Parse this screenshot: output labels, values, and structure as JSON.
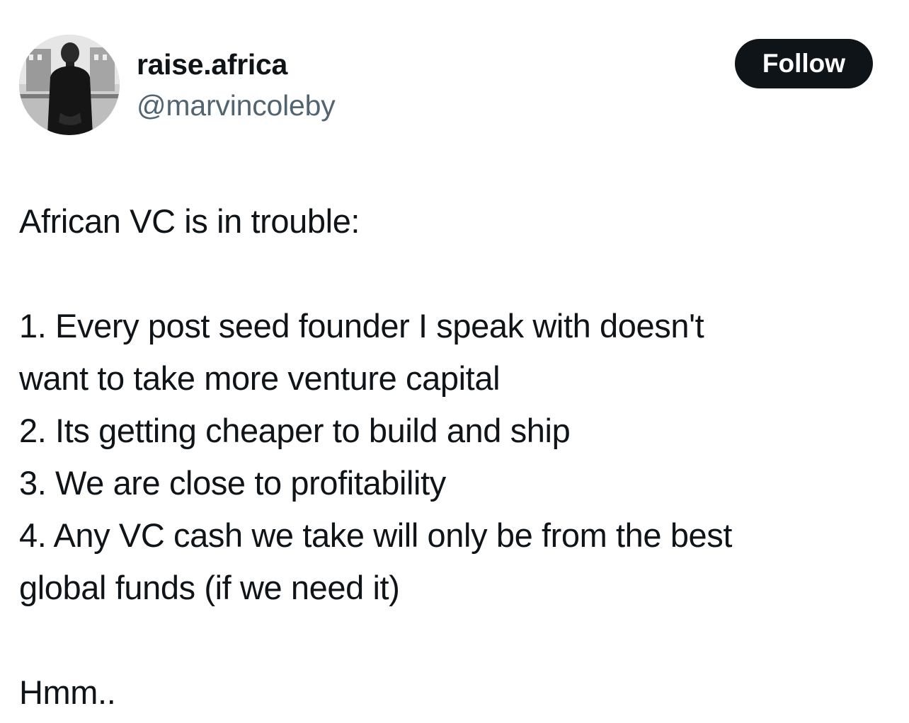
{
  "author": {
    "display_name": "raise.africa",
    "handle": "@marvincoleby",
    "avatar_icon": "profile-photo-avatar"
  },
  "actions": {
    "follow_label": "Follow"
  },
  "tweet": {
    "intro": "African VC is in trouble:",
    "lines": [
      "1. Every post seed founder I speak with doesn't",
      "want to take more venture capital",
      "2. Its getting cheaper to build and ship",
      "3. We are close to profitability",
      "4. Any VC cash we take will only be from the best",
      "global funds (if we need it)"
    ],
    "outro": "Hmm.."
  },
  "colors": {
    "text_primary": "#0f1419",
    "text_secondary": "#536471",
    "button_bg": "#0f1419",
    "button_text": "#ffffff"
  }
}
